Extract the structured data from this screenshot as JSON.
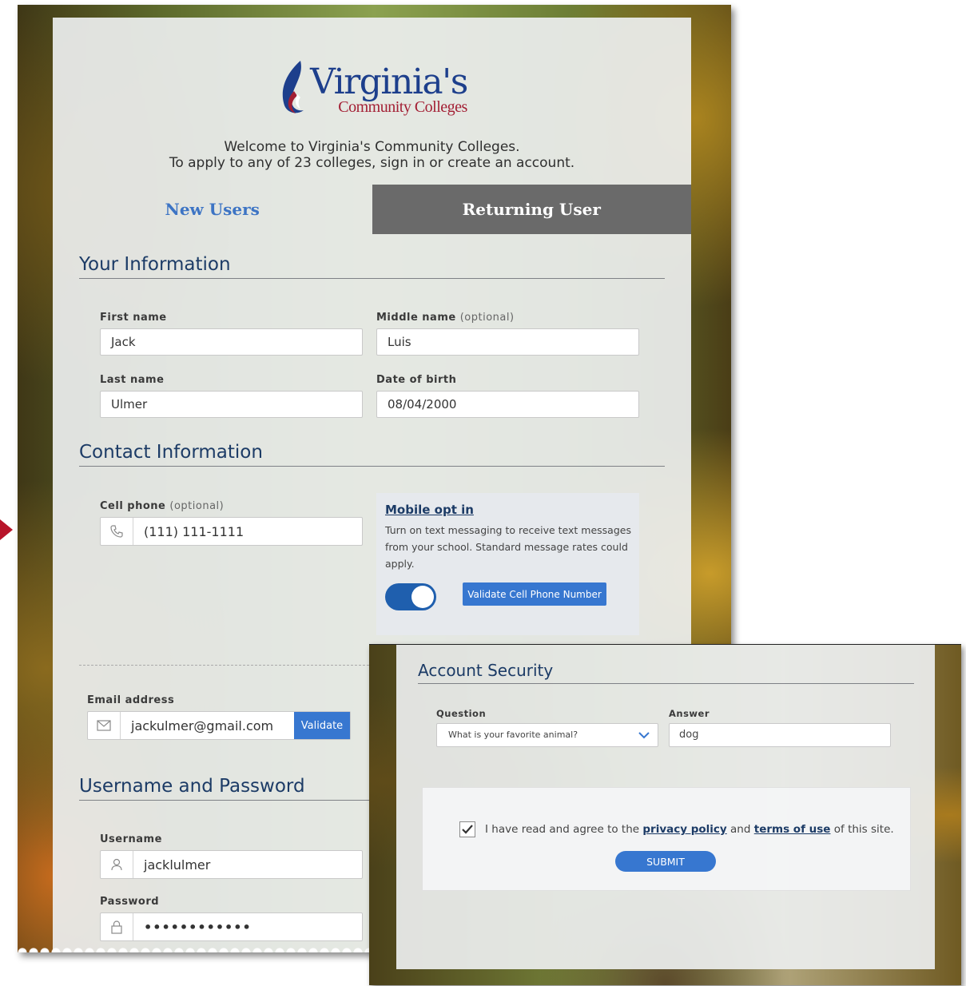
{
  "logo": {
    "main": "Virginia's",
    "sub": "Community Colleges"
  },
  "welcome": {
    "line1": "Welcome to Virginia's Community Colleges.",
    "line2": "To apply to any of 23 colleges, sign in or create an account."
  },
  "tabs": {
    "new_users": "New Users",
    "returning_user": "Returning User"
  },
  "your_info": {
    "title": "Your Information",
    "first_name_label": "First name",
    "first_name_value": "Jack",
    "middle_name_label": "Middle name",
    "middle_name_optional": "(optional)",
    "middle_name_value": "Luis",
    "last_name_label": "Last name",
    "last_name_value": "Ulmer",
    "dob_label": "Date of birth",
    "dob_value": "08/04/2000"
  },
  "contact": {
    "title": "Contact Information",
    "cell_label": "Cell phone",
    "cell_optional": "(optional)",
    "cell_value": "(111) 111-1111",
    "optin_title": "Mobile opt in",
    "optin_text": "Turn on text messaging to receive text messages from your school. Standard message rates could apply.",
    "optin_enabled": true,
    "validate_phone_label": "Validate Cell Phone Number",
    "email_label": "Email address",
    "email_value": "jackulmer@gmail.com",
    "validate_email_label": "Validate"
  },
  "credentials": {
    "title": "Username and Password",
    "username_label": "Username",
    "username_value": "jacklulmer",
    "password_label": "Password",
    "password_value": "••••••••••••"
  },
  "security": {
    "title": "Account Security",
    "question_label": "Question",
    "question_value": "What is your favorite animal?",
    "answer_label": "Answer",
    "answer_value": "dog"
  },
  "agreement": {
    "checked": true,
    "text_before": "I have read and agree to the",
    "privacy_link": "privacy policy",
    "and": "and",
    "terms_link": "terms of use",
    "text_after": "of this site.",
    "submit_label": "SUBMIT"
  },
  "colors": {
    "primary_blue": "#3777d0",
    "heading_navy": "#1c3b66",
    "tab_inactive_bg": "#6a6a6a",
    "logo_red": "#a31f34",
    "arrow_red": "#b8142a"
  }
}
